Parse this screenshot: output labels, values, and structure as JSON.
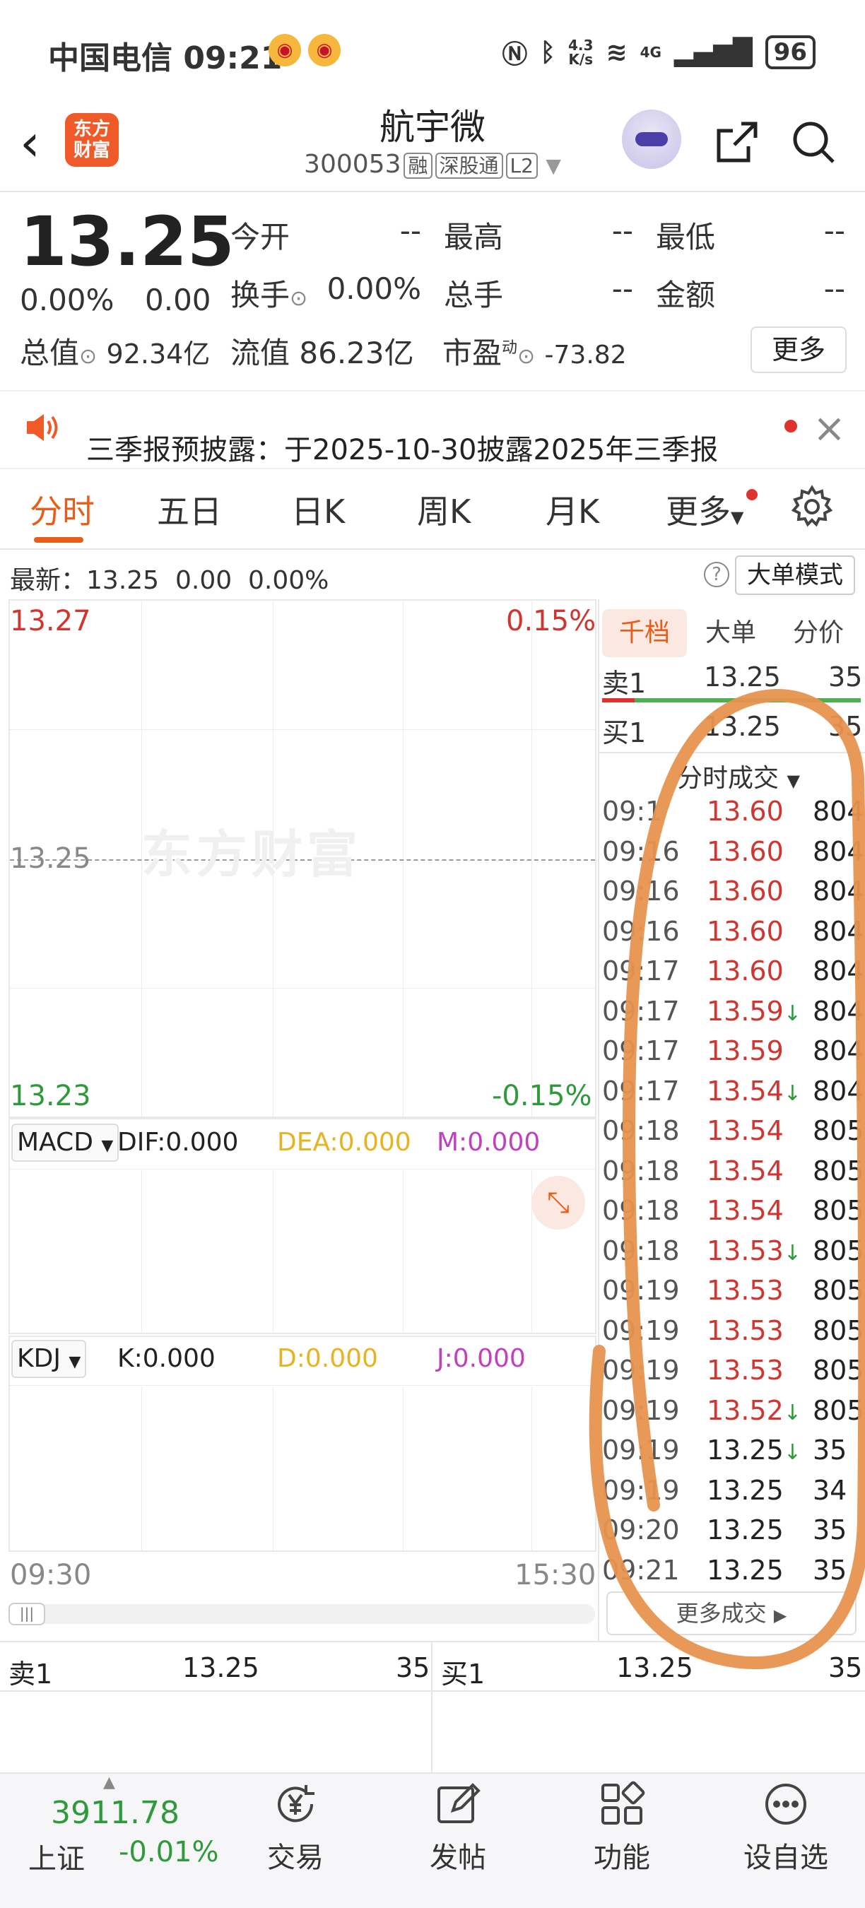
{
  "status_bar": {
    "carrier": "中国电信",
    "time": "09:21",
    "speed_top": "4.3",
    "speed_bottom": "K/s",
    "network": "4G",
    "battery": "96"
  },
  "header": {
    "logo_line1": "东方",
    "logo_line2": "财富",
    "name": "航宇微",
    "code": "300053",
    "tags": [
      "融",
      "深股通",
      "L2"
    ]
  },
  "quote": {
    "price": "13.25",
    "change_pct": "0.00%",
    "change_val": "0.00",
    "fields": [
      {
        "label": "今开",
        "value": "--"
      },
      {
        "label": "最高",
        "value": "--"
      },
      {
        "label": "最低",
        "value": "--"
      },
      {
        "label": "换手",
        "value": "0.00%"
      },
      {
        "label": "总手",
        "value": "--"
      },
      {
        "label": "金额",
        "value": "--"
      }
    ],
    "total_cap_label": "总值",
    "total_cap": "92.34亿",
    "float_cap_label": "流值",
    "float_cap": "86.23亿",
    "pe_label": "市盈",
    "pe_sup": "动",
    "pe": "-73.82",
    "more": "更多"
  },
  "notice": {
    "text": "三季报预披露：于2025-10-30披露2025年三季报"
  },
  "tabs": [
    "分时",
    "五日",
    "日K",
    "周K",
    "月K",
    "更多"
  ],
  "latest": {
    "label": "最新：",
    "price": "13.25",
    "change": "0.00",
    "pct": "0.00%",
    "big_order_mode": "大单模式"
  },
  "chart": {
    "top_price": "13.27",
    "top_pct": "0.15%",
    "mid_price": "13.25",
    "bottom_price": "13.23",
    "bottom_pct": "-0.15%",
    "watermark": "东方财富",
    "macd": {
      "name": "MACD",
      "dif": "DIF:0.000",
      "dea": "DEA:0.000",
      "m": "M:0.000"
    },
    "kdj": {
      "name": "KDJ",
      "k": "K:0.000",
      "d": "D:0.000",
      "j": "J:0.000"
    },
    "start_time": "09:30",
    "end_time": "15:30"
  },
  "right_panel": {
    "tabs": [
      "千档",
      "大单",
      "分价"
    ],
    "sell1": {
      "label": "卖1",
      "price": "13.25",
      "vol": "35"
    },
    "buy1": {
      "label": "买1",
      "price": "13.25",
      "vol": "35"
    },
    "ticks_title": "分时成交",
    "ticks": [
      {
        "time": "09:1",
        "price": "13.60",
        "arrow": "",
        "vol": "804",
        "color": "red"
      },
      {
        "time": "09:16",
        "price": "13.60",
        "arrow": "",
        "vol": "804",
        "color": "red"
      },
      {
        "time": "09:16",
        "price": "13.60",
        "arrow": "",
        "vol": "804",
        "color": "red"
      },
      {
        "time": "09:16",
        "price": "13.60",
        "arrow": "",
        "vol": "804",
        "color": "red"
      },
      {
        "time": "09:17",
        "price": "13.60",
        "arrow": "",
        "vol": "804",
        "color": "red"
      },
      {
        "time": "09:17",
        "price": "13.59",
        "arrow": "↓",
        "vol": "804",
        "color": "red"
      },
      {
        "time": "09:17",
        "price": "13.59",
        "arrow": "",
        "vol": "804",
        "color": "red"
      },
      {
        "time": "09:17",
        "price": "13.54",
        "arrow": "↓",
        "vol": "804",
        "color": "red"
      },
      {
        "time": "09:18",
        "price": "13.54",
        "arrow": "",
        "vol": "805",
        "color": "red"
      },
      {
        "time": "09:18",
        "price": "13.54",
        "arrow": "",
        "vol": "805",
        "color": "red"
      },
      {
        "time": "09:18",
        "price": "13.54",
        "arrow": "",
        "vol": "805",
        "color": "red"
      },
      {
        "time": "09:18",
        "price": "13.53",
        "arrow": "↓",
        "vol": "805",
        "color": "red"
      },
      {
        "time": "09:19",
        "price": "13.53",
        "arrow": "",
        "vol": "805",
        "color": "red"
      },
      {
        "time": "09:19",
        "price": "13.53",
        "arrow": "",
        "vol": "805",
        "color": "red"
      },
      {
        "time": "09:19",
        "price": "13.53",
        "arrow": "",
        "vol": "805",
        "color": "red"
      },
      {
        "time": "09:19",
        "price": "13.52",
        "arrow": "↓",
        "vol": "805",
        "color": "red"
      },
      {
        "time": "09:19",
        "price": "13.25",
        "arrow": "↓",
        "vol": "35",
        "color": "dark"
      },
      {
        "time": "09:19",
        "price": "13.25",
        "arrow": "",
        "vol": "34",
        "color": "dark"
      },
      {
        "time": "09:20",
        "price": "13.25",
        "arrow": "",
        "vol": "35",
        "color": "dark"
      },
      {
        "time": "09:21",
        "price": "13.25",
        "arrow": "",
        "vol": "35",
        "color": "dark"
      }
    ],
    "more_trades": "更多成交"
  },
  "order_row": {
    "sell_label": "卖1",
    "sell_price": "13.25",
    "sell_vol": "35",
    "buy_label": "买1",
    "buy_price": "13.25",
    "buy_vol": "35"
  },
  "bottom_nav": {
    "index_value": "3911.78",
    "index_name": "上证",
    "index_pct": "-0.01%",
    "items": [
      "交易",
      "发帖",
      "功能",
      "设自选"
    ]
  },
  "colors": {
    "accent": "#e85d1a",
    "up": "#d0352f",
    "down": "#2e9a3c",
    "annotation": "#e8944e"
  }
}
